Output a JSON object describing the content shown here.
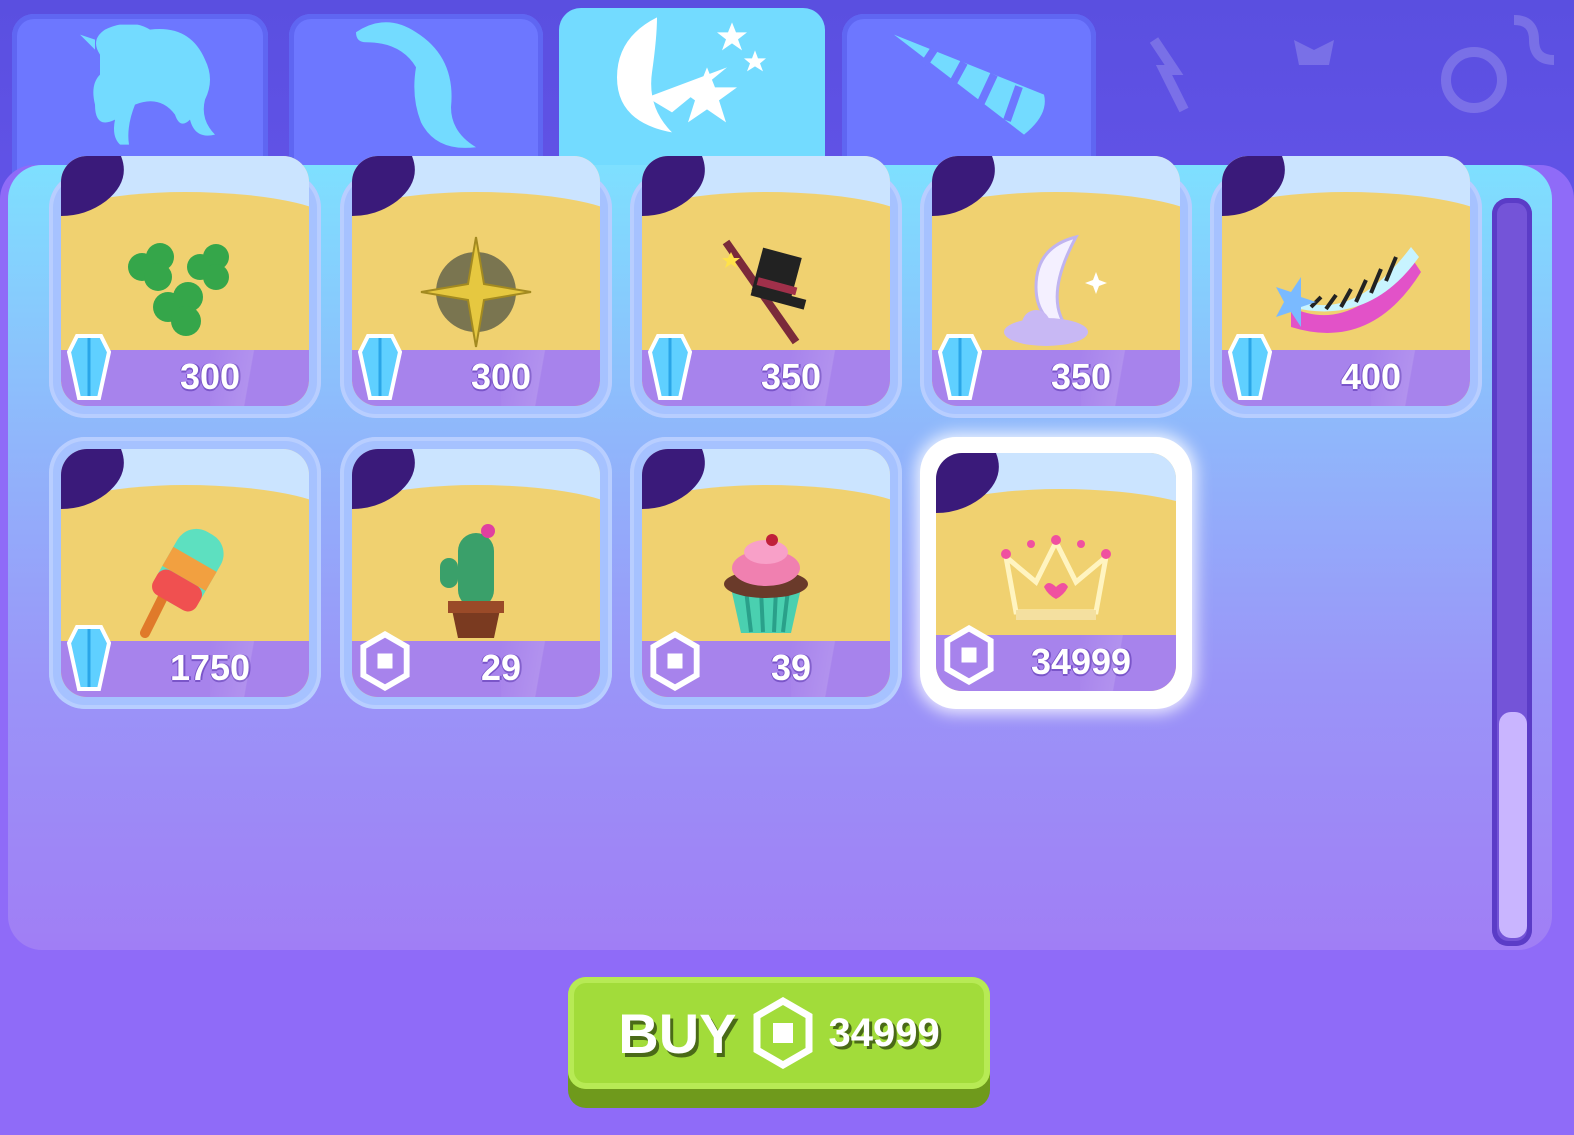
{
  "tabs": [
    {
      "name": "mane",
      "icon": "mane-icon",
      "active": false
    },
    {
      "name": "tail",
      "icon": "tail-icon",
      "active": false
    },
    {
      "name": "cutie-mark",
      "icon": "moon-stars-icon",
      "active": true
    },
    {
      "name": "horn",
      "icon": "horn-icon",
      "active": false
    }
  ],
  "items": [
    {
      "id": "clovers",
      "price": "300",
      "currency": "gem-icon",
      "design": "clover-icon"
    },
    {
      "id": "compass",
      "price": "300",
      "currency": "gem-icon",
      "design": "compass-star-icon"
    },
    {
      "id": "magic-hat",
      "price": "350",
      "currency": "gem-icon",
      "design": "top-hat-wand-icon"
    },
    {
      "id": "moon-cloud",
      "price": "350",
      "currency": "gem-icon",
      "design": "moon-cloud-icon"
    },
    {
      "id": "piano",
      "price": "400",
      "currency": "gem-icon",
      "design": "piano-keys-icon"
    },
    {
      "id": "ice-pop",
      "price": "1750",
      "currency": "gem-icon",
      "design": "popsicle-icon"
    },
    {
      "id": "cactus",
      "price": "29",
      "currency": "robux-icon",
      "design": "cactus-icon"
    },
    {
      "id": "cupcake",
      "price": "39",
      "currency": "robux-icon",
      "design": "cupcake-icon"
    },
    {
      "id": "crown",
      "price": "34999",
      "currency": "robux-icon",
      "design": "crown-icon",
      "selected": true
    }
  ],
  "buy": {
    "label": "BUY",
    "price": "34999",
    "currency": "robux-icon"
  },
  "colors": {
    "background": "#6b57f0",
    "active_tab": "#73dbff",
    "tab": "#6d77ff",
    "buy_button": "#a2dc3a",
    "price_bar": "#a783ec"
  },
  "scroll": {
    "position": 0.7
  }
}
